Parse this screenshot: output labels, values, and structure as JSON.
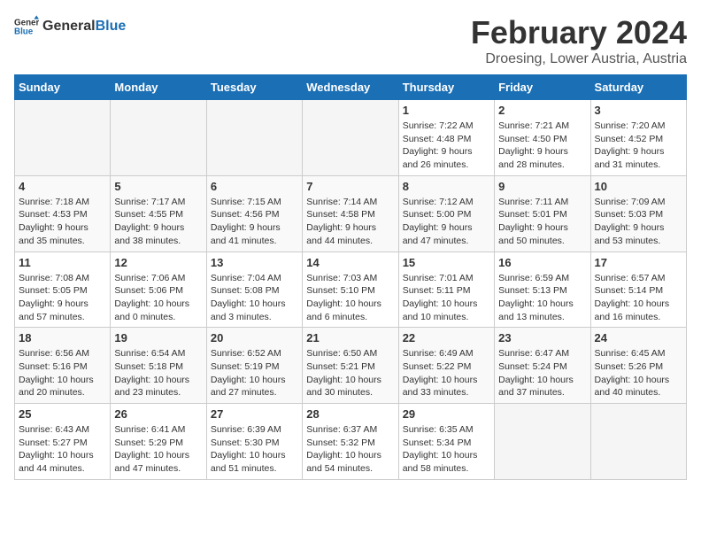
{
  "logo": {
    "text_general": "General",
    "text_blue": "Blue"
  },
  "title": "February 2024",
  "subtitle": "Droesing, Lower Austria, Austria",
  "days_of_week": [
    "Sunday",
    "Monday",
    "Tuesday",
    "Wednesday",
    "Thursday",
    "Friday",
    "Saturday"
  ],
  "weeks": [
    [
      {
        "day": "",
        "detail": ""
      },
      {
        "day": "",
        "detail": ""
      },
      {
        "day": "",
        "detail": ""
      },
      {
        "day": "",
        "detail": ""
      },
      {
        "day": "1",
        "detail": "Sunrise: 7:22 AM\nSunset: 4:48 PM\nDaylight: 9 hours\nand 26 minutes."
      },
      {
        "day": "2",
        "detail": "Sunrise: 7:21 AM\nSunset: 4:50 PM\nDaylight: 9 hours\nand 28 minutes."
      },
      {
        "day": "3",
        "detail": "Sunrise: 7:20 AM\nSunset: 4:52 PM\nDaylight: 9 hours\nand 31 minutes."
      }
    ],
    [
      {
        "day": "4",
        "detail": "Sunrise: 7:18 AM\nSunset: 4:53 PM\nDaylight: 9 hours\nand 35 minutes."
      },
      {
        "day": "5",
        "detail": "Sunrise: 7:17 AM\nSunset: 4:55 PM\nDaylight: 9 hours\nand 38 minutes."
      },
      {
        "day": "6",
        "detail": "Sunrise: 7:15 AM\nSunset: 4:56 PM\nDaylight: 9 hours\nand 41 minutes."
      },
      {
        "day": "7",
        "detail": "Sunrise: 7:14 AM\nSunset: 4:58 PM\nDaylight: 9 hours\nand 44 minutes."
      },
      {
        "day": "8",
        "detail": "Sunrise: 7:12 AM\nSunset: 5:00 PM\nDaylight: 9 hours\nand 47 minutes."
      },
      {
        "day": "9",
        "detail": "Sunrise: 7:11 AM\nSunset: 5:01 PM\nDaylight: 9 hours\nand 50 minutes."
      },
      {
        "day": "10",
        "detail": "Sunrise: 7:09 AM\nSunset: 5:03 PM\nDaylight: 9 hours\nand 53 minutes."
      }
    ],
    [
      {
        "day": "11",
        "detail": "Sunrise: 7:08 AM\nSunset: 5:05 PM\nDaylight: 9 hours\nand 57 minutes."
      },
      {
        "day": "12",
        "detail": "Sunrise: 7:06 AM\nSunset: 5:06 PM\nDaylight: 10 hours\nand 0 minutes."
      },
      {
        "day": "13",
        "detail": "Sunrise: 7:04 AM\nSunset: 5:08 PM\nDaylight: 10 hours\nand 3 minutes."
      },
      {
        "day": "14",
        "detail": "Sunrise: 7:03 AM\nSunset: 5:10 PM\nDaylight: 10 hours\nand 6 minutes."
      },
      {
        "day": "15",
        "detail": "Sunrise: 7:01 AM\nSunset: 5:11 PM\nDaylight: 10 hours\nand 10 minutes."
      },
      {
        "day": "16",
        "detail": "Sunrise: 6:59 AM\nSunset: 5:13 PM\nDaylight: 10 hours\nand 13 minutes."
      },
      {
        "day": "17",
        "detail": "Sunrise: 6:57 AM\nSunset: 5:14 PM\nDaylight: 10 hours\nand 16 minutes."
      }
    ],
    [
      {
        "day": "18",
        "detail": "Sunrise: 6:56 AM\nSunset: 5:16 PM\nDaylight: 10 hours\nand 20 minutes."
      },
      {
        "day": "19",
        "detail": "Sunrise: 6:54 AM\nSunset: 5:18 PM\nDaylight: 10 hours\nand 23 minutes."
      },
      {
        "day": "20",
        "detail": "Sunrise: 6:52 AM\nSunset: 5:19 PM\nDaylight: 10 hours\nand 27 minutes."
      },
      {
        "day": "21",
        "detail": "Sunrise: 6:50 AM\nSunset: 5:21 PM\nDaylight: 10 hours\nand 30 minutes."
      },
      {
        "day": "22",
        "detail": "Sunrise: 6:49 AM\nSunset: 5:22 PM\nDaylight: 10 hours\nand 33 minutes."
      },
      {
        "day": "23",
        "detail": "Sunrise: 6:47 AM\nSunset: 5:24 PM\nDaylight: 10 hours\nand 37 minutes."
      },
      {
        "day": "24",
        "detail": "Sunrise: 6:45 AM\nSunset: 5:26 PM\nDaylight: 10 hours\nand 40 minutes."
      }
    ],
    [
      {
        "day": "25",
        "detail": "Sunrise: 6:43 AM\nSunset: 5:27 PM\nDaylight: 10 hours\nand 44 minutes."
      },
      {
        "day": "26",
        "detail": "Sunrise: 6:41 AM\nSunset: 5:29 PM\nDaylight: 10 hours\nand 47 minutes."
      },
      {
        "day": "27",
        "detail": "Sunrise: 6:39 AM\nSunset: 5:30 PM\nDaylight: 10 hours\nand 51 minutes."
      },
      {
        "day": "28",
        "detail": "Sunrise: 6:37 AM\nSunset: 5:32 PM\nDaylight: 10 hours\nand 54 minutes."
      },
      {
        "day": "29",
        "detail": "Sunrise: 6:35 AM\nSunset: 5:34 PM\nDaylight: 10 hours\nand 58 minutes."
      },
      {
        "day": "",
        "detail": ""
      },
      {
        "day": "",
        "detail": ""
      }
    ]
  ]
}
